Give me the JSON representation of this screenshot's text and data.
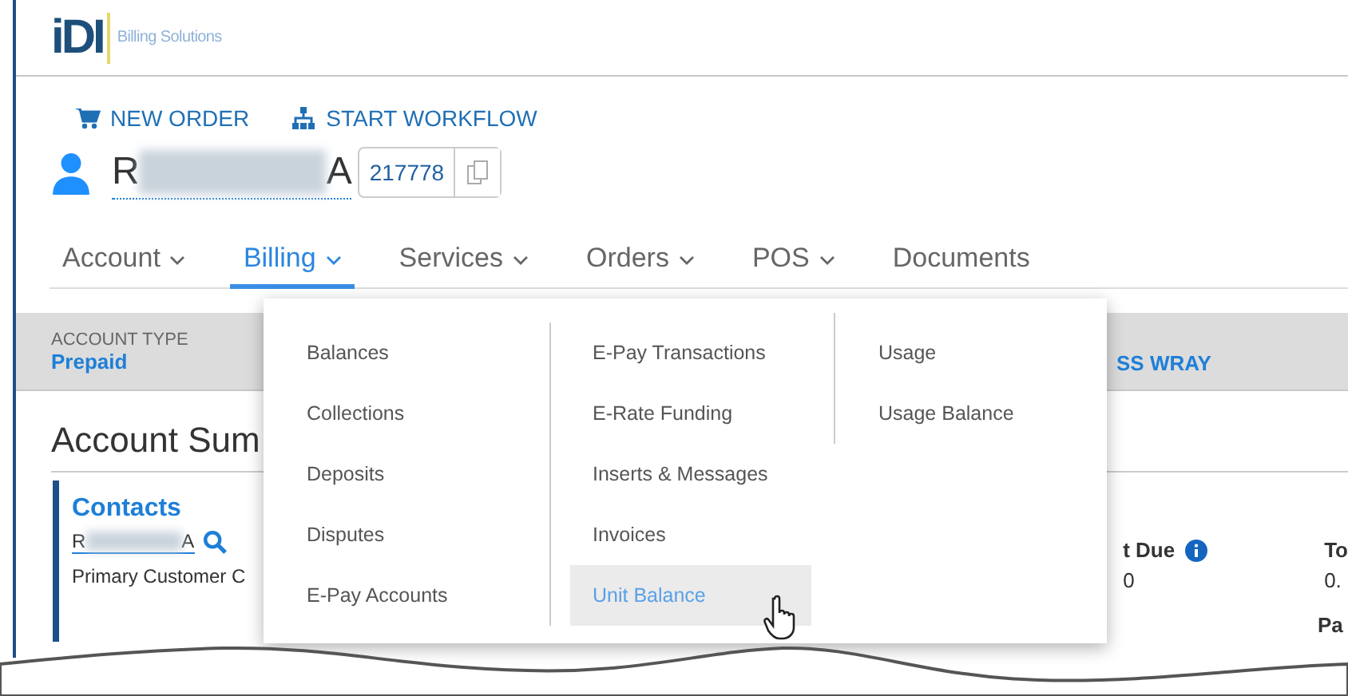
{
  "logo": {
    "mark": "iDI",
    "tagline": "Billing Solutions"
  },
  "actions": [
    {
      "label": "NEW ORDER",
      "kind": "cart"
    },
    {
      "label": "START WORKFLOW",
      "kind": "workflow"
    }
  ],
  "customer": {
    "name_start": "R",
    "name_end": "A",
    "account_number": "217778"
  },
  "nav": [
    {
      "label": "Account",
      "dropdown": true,
      "selected": false
    },
    {
      "label": "Billing",
      "dropdown": true,
      "selected": true
    },
    {
      "label": "Services",
      "dropdown": true,
      "selected": false
    },
    {
      "label": "Orders",
      "dropdown": true,
      "selected": false
    },
    {
      "label": "POS",
      "dropdown": true,
      "selected": false
    },
    {
      "label": "Documents",
      "dropdown": false,
      "selected": false
    }
  ],
  "band": {
    "account_type_label": "ACCOUNT TYPE",
    "account_type": "Prepaid",
    "partial_value": "SS WRAY"
  },
  "summary_title": "Account Sum",
  "contacts": {
    "title": "Contacts",
    "name_start": "R",
    "name_end": "A",
    "role": "Primary Customer C"
  },
  "balance_fields": [
    {
      "label": "t Due",
      "value": "0",
      "info": true
    },
    {
      "label": "To",
      "value": "0.",
      "info": false
    }
  ],
  "extra_label": "Pa",
  "menu": {
    "columns": [
      [
        {
          "label": "Balances",
          "selected": false
        },
        {
          "label": "Collections",
          "selected": false
        },
        {
          "label": "Deposits",
          "selected": false
        },
        {
          "label": "Disputes",
          "selected": false
        },
        {
          "label": "E-Pay Accounts",
          "selected": false
        }
      ],
      [
        {
          "label": "E-Pay Transactions",
          "selected": false
        },
        {
          "label": "E-Rate Funding",
          "selected": false
        },
        {
          "label": "Inserts & Messages",
          "selected": false
        },
        {
          "label": "Invoices",
          "selected": false
        },
        {
          "label": "Unit Balance",
          "selected": true
        }
      ],
      [
        {
          "label": "Usage",
          "selected": false
        },
        {
          "label": "Usage Balance",
          "selected": false
        }
      ]
    ]
  }
}
